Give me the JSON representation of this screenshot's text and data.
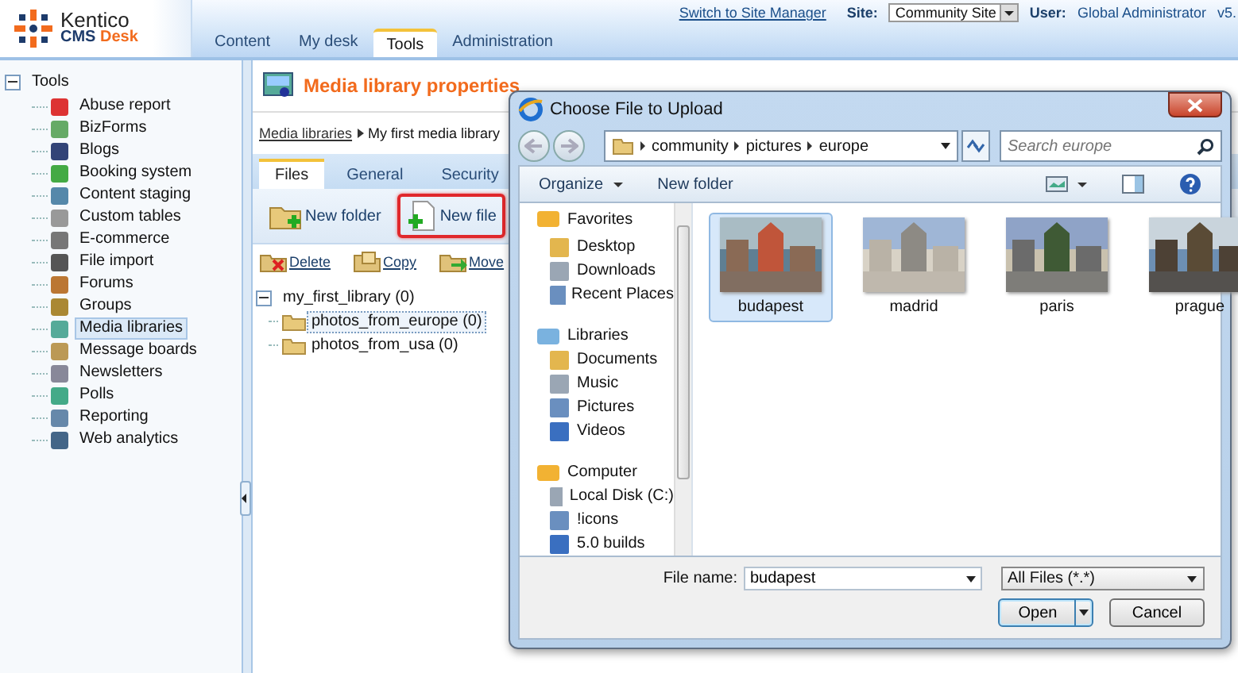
{
  "header": {
    "logo": {
      "name": "Kentico",
      "product": "CMS",
      "edition": "Desk"
    },
    "switch_link": "Switch to Site Manager",
    "site_label": "Site:",
    "site_value": "Community Site",
    "user_label": "User:",
    "user_value": "Global Administrator",
    "version": "v5.",
    "tabs": [
      {
        "label": "Content",
        "selected": false
      },
      {
        "label": "My desk",
        "selected": false
      },
      {
        "label": "Tools",
        "selected": true
      },
      {
        "label": "Administration",
        "selected": false
      }
    ]
  },
  "tree": {
    "root": "Tools",
    "expanded": true,
    "items": [
      {
        "label": "Abuse report",
        "selected": false
      },
      {
        "label": "BizForms",
        "selected": false
      },
      {
        "label": "Blogs",
        "selected": false
      },
      {
        "label": "Booking system",
        "selected": false
      },
      {
        "label": "Content staging",
        "selected": false
      },
      {
        "label": "Custom tables",
        "selected": false
      },
      {
        "label": "E-commerce",
        "selected": false
      },
      {
        "label": "File import",
        "selected": false
      },
      {
        "label": "Forums",
        "selected": false
      },
      {
        "label": "Groups",
        "selected": false
      },
      {
        "label": "Media libraries",
        "selected": true
      },
      {
        "label": "Message boards",
        "selected": false
      },
      {
        "label": "Newsletters",
        "selected": false
      },
      {
        "label": "Polls",
        "selected": false
      },
      {
        "label": "Reporting",
        "selected": false
      },
      {
        "label": "Web analytics",
        "selected": false
      }
    ]
  },
  "content": {
    "title": "Media library properties",
    "breadcrumb": [
      "Media libraries",
      "My first media library"
    ],
    "tabs": [
      {
        "label": "Files",
        "selected": true
      },
      {
        "label": "General",
        "selected": false
      },
      {
        "label": "Security",
        "selected": false
      }
    ],
    "toolbar": [
      {
        "label": "New folder",
        "highlighted": false
      },
      {
        "label": "New file",
        "highlighted": true
      }
    ],
    "actions": [
      "Delete",
      "Copy",
      "Move"
    ],
    "library_tree": {
      "label": "my_first_library (0)",
      "expanded": true,
      "children": [
        {
          "label": "photos_from_europe (0)",
          "selected": true
        },
        {
          "label": "photos_from_usa (0)",
          "selected": false
        }
      ]
    }
  },
  "dialog": {
    "title": "Choose File to Upload",
    "path": [
      "community",
      "pictures",
      "europe"
    ],
    "search_placeholder": "Search europe",
    "toolbar": [
      "Organize",
      "New folder"
    ],
    "nav": [
      {
        "label": "Favorites",
        "kind": "group"
      },
      {
        "label": "Desktop",
        "kind": "item"
      },
      {
        "label": "Downloads",
        "kind": "item"
      },
      {
        "label": "Recent Places",
        "kind": "item"
      },
      {
        "label": "Libraries",
        "kind": "group"
      },
      {
        "label": "Documents",
        "kind": "item"
      },
      {
        "label": "Music",
        "kind": "item"
      },
      {
        "label": "Pictures",
        "kind": "item"
      },
      {
        "label": "Videos",
        "kind": "item"
      },
      {
        "label": "Computer",
        "kind": "group"
      },
      {
        "label": "Local Disk (C:)",
        "kind": "item"
      },
      {
        "label": "!icons",
        "kind": "item"
      },
      {
        "label": "5.0 builds",
        "kind": "item"
      }
    ],
    "files": [
      {
        "name": "budapest",
        "selected": true,
        "kind": "picture"
      },
      {
        "name": "madrid",
        "selected": false,
        "kind": "picture"
      },
      {
        "name": "paris",
        "selected": false,
        "kind": "picture"
      },
      {
        "name": "prague",
        "selected": false,
        "kind": "picture"
      }
    ],
    "file_name_label": "File name:",
    "file_name": "budapest",
    "filter": "All Files (*.*)",
    "buttons": [
      "Open",
      "Cancel"
    ]
  }
}
